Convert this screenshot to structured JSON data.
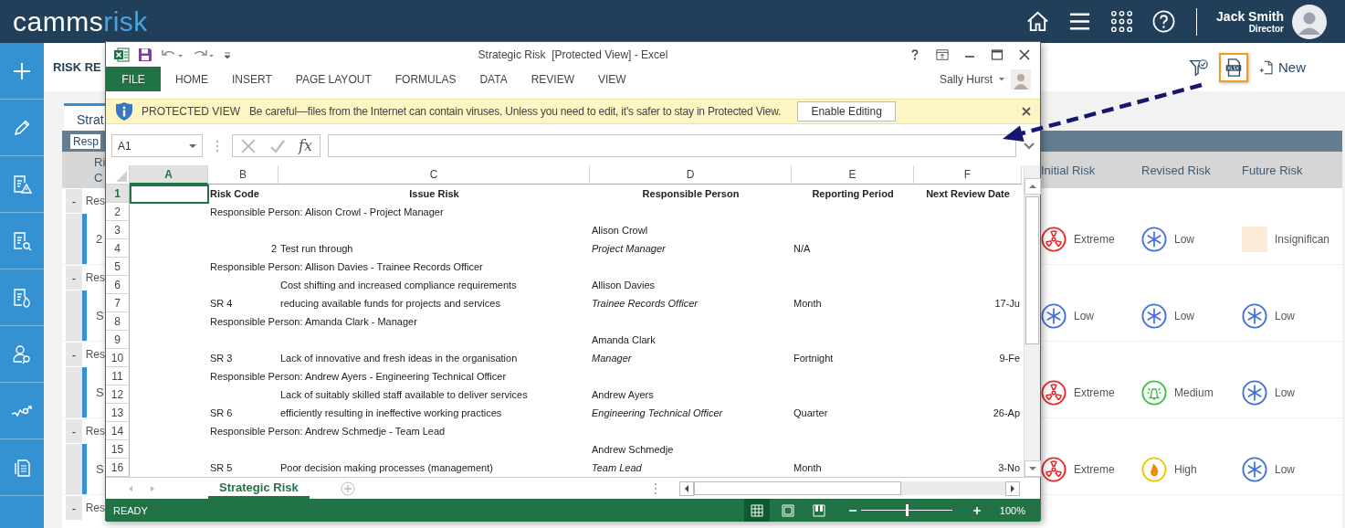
{
  "header": {
    "logo": {
      "main": "camms",
      "accent": "risk"
    },
    "user": {
      "name": "Jack Smith",
      "role": "Director"
    }
  },
  "page": {
    "title": "RISK RE",
    "tools": [
      {
        "kind": "filter",
        "highlighted": false
      },
      {
        "kind": "export",
        "highlighted": true
      },
      {
        "kind": "new",
        "highlighted": false,
        "label": "New"
      }
    ]
  },
  "register": {
    "tab": "Strat",
    "group_field": "Resp",
    "column_1": [
      "Ri",
      "C"
    ],
    "risk_columns": [
      "Initial Risk",
      "Revised Risk",
      "Future Risk"
    ],
    "groups": [
      {
        "toggle": "-",
        "label": "Res",
        "code": "2",
        "ratings": [
          {
            "kind": "extreme",
            "label": "Extreme"
          },
          {
            "kind": "low",
            "label": "Low"
          },
          {
            "kind": "insignificant",
            "label": "Insignifican"
          }
        ]
      },
      {
        "toggle": "-",
        "label": "Res",
        "code": "S",
        "ratings": [
          {
            "kind": "low",
            "label": "Low"
          },
          {
            "kind": "low",
            "label": "Low"
          },
          {
            "kind": "low",
            "label": "Low"
          }
        ]
      },
      {
        "toggle": "-",
        "label": "Res",
        "code": "S",
        "ratings": [
          {
            "kind": "extreme",
            "label": "Extreme"
          },
          {
            "kind": "medium",
            "label": "Medium"
          },
          {
            "kind": "low",
            "label": "Low"
          }
        ]
      },
      {
        "toggle": "-",
        "label": "Res",
        "code": "S",
        "ratings": [
          {
            "kind": "extreme",
            "label": "Extreme"
          },
          {
            "kind": "high",
            "label": "High"
          },
          {
            "kind": "low",
            "label": "Low"
          }
        ]
      },
      {
        "toggle": "-",
        "label": "Res"
      }
    ]
  },
  "excel": {
    "title": "Strategic Risk  [Protected View] - Excel",
    "ribbon_tabs": [
      {
        "label": "FILE",
        "kind": "backstage"
      },
      {
        "label": "HOME",
        "kind": "tab"
      },
      {
        "label": "INSERT",
        "kind": "tab"
      },
      {
        "label": "PAGE LAYOUT",
        "kind": "tab"
      },
      {
        "label": "FORMULAS",
        "kind": "tab"
      },
      {
        "label": "DATA",
        "kind": "tab"
      },
      {
        "label": "REVIEW",
        "kind": "tab"
      },
      {
        "label": "VIEW",
        "kind": "tab"
      }
    ],
    "account": "Sally Hurst",
    "protected_view": {
      "label": "PROTECTED VIEW",
      "message": "Be careful—files from the Internet can contain viruses. Unless you need to edit, it's safer to stay in Protected View.",
      "button": "Enable Editing"
    },
    "name_box": "A1",
    "formula_label": "fx",
    "columns": [
      {
        "label": "A",
        "selected": true
      },
      {
        "label": "B",
        "selected": false
      },
      {
        "label": "C",
        "selected": false
      },
      {
        "label": "D",
        "selected": false
      },
      {
        "label": "E",
        "selected": false
      },
      {
        "label": "F",
        "selected": false
      }
    ],
    "rows": [
      {
        "number": "1",
        "selected": true,
        "kind": "header",
        "cells": {
          "B": "Risk Code",
          "C": "Issue Risk",
          "D": "Responsible Person",
          "E": "Reporting Period",
          "F": "Next Review Date"
        }
      },
      {
        "number": "2",
        "selected": false,
        "kind": "group",
        "cells": {
          "B": "Responsible Person: Alison Crowl - Project Manager"
        }
      },
      {
        "number": "3",
        "selected": false,
        "kind": "name",
        "cells": {
          "D": "Alison Crowl"
        }
      },
      {
        "number": "4",
        "selected": false,
        "kind": "detail",
        "numeric_code": true,
        "cells": {
          "B": "2",
          "C": "Test run through",
          "D": "Project Manager",
          "E": "N/A"
        }
      },
      {
        "number": "5",
        "selected": false,
        "kind": "group",
        "cells": {
          "B": "Responsible Person: Allison Davies - Trainee Records Officer"
        }
      },
      {
        "number": "6",
        "selected": false,
        "kind": "name",
        "cells": {
          "C": "Cost shifting and increased compliance requirements",
          "D": "Allison Davies"
        }
      },
      {
        "number": "7",
        "selected": false,
        "kind": "detail",
        "cells": {
          "B": "SR 4",
          "C": "reducing available funds for projects and services",
          "D": "Trainee Records Officer",
          "E": "Month",
          "F": "17-Ju"
        }
      },
      {
        "number": "8",
        "selected": false,
        "kind": "group",
        "cells": {
          "B": "Responsible Person: Amanda Clark - Manager"
        }
      },
      {
        "number": "9",
        "selected": false,
        "kind": "name",
        "cells": {
          "D": "Amanda Clark"
        }
      },
      {
        "number": "10",
        "selected": false,
        "kind": "detail",
        "cells": {
          "B": "SR 3",
          "C": "Lack of innovative and fresh ideas in the organisation",
          "D": "Manager",
          "E": "Fortnight",
          "F": "9-Fe"
        }
      },
      {
        "number": "11",
        "selected": false,
        "kind": "group",
        "cells": {
          "B": "Responsible Person: Andrew Ayers - Engineering Technical Officer"
        }
      },
      {
        "number": "12",
        "selected": false,
        "kind": "name",
        "cells": {
          "C": "Lack of suitably skilled staff available to deliver services",
          "D": "Andrew Ayers"
        }
      },
      {
        "number": "13",
        "selected": false,
        "kind": "detail",
        "cells": {
          "B": "SR 6",
          "C": "efficiently resulting in ineffective working practices",
          "D": "Engineering Technical Officer",
          "E": "Quarter",
          "F": "26-Ap"
        }
      },
      {
        "number": "14",
        "selected": false,
        "kind": "group",
        "cells": {
          "B": "Responsible Person: Andrew Schmedje - Team Lead"
        }
      },
      {
        "number": "15",
        "selected": false,
        "kind": "name",
        "cells": {
          "D": "Andrew Schmedje"
        }
      },
      {
        "number": "16",
        "selected": false,
        "kind": "detail",
        "cells": {
          "B": "SR 5",
          "C": "Poor decision making processes (management)",
          "D": "Team Lead",
          "E": "Month",
          "F": "3-No"
        }
      }
    ],
    "sheet_tabs": [
      {
        "label": "Strategic Risk",
        "selected": true
      }
    ],
    "status": "READY",
    "views": [
      {
        "kind": "normal",
        "selected": true
      },
      {
        "kind": "page_layout",
        "selected": false
      },
      {
        "kind": "page_break",
        "selected": false
      }
    ],
    "zoom": {
      "level": 0.5,
      "reading": "100%"
    }
  }
}
